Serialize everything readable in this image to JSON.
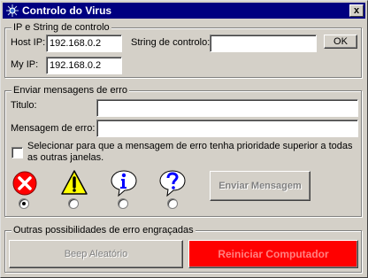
{
  "window": {
    "title": "Controlo do Virus",
    "close_label": "x"
  },
  "ip_group": {
    "legend": "IP e String de controlo",
    "host_ip_label": "Host IP:",
    "host_ip_value": "192.168.0.2",
    "my_ip_label": "My IP:",
    "my_ip_value": "192.168.0.2",
    "control_string_label": "String de controlo:",
    "control_string_value": "",
    "ok_label": "OK"
  },
  "error_group": {
    "legend": "Enviar mensagens de erro",
    "title_label": "Titulo:",
    "title_value": "",
    "message_label": "Mensagem de erro:",
    "message_value": "",
    "priority_checkbox_label": "Selecionar para que a mensagem de erro tenha prioridade superior a todas as outras janelas.",
    "priority_checked": false,
    "icons": [
      "error-icon",
      "warning-icon",
      "information-icon",
      "question-icon"
    ],
    "selected_icon_index": 0,
    "send_label": "Enviar Mensagem"
  },
  "fun_group": {
    "legend": "Outras possibilidades de erro engraçadas",
    "beep_label": "Beep Aleatório",
    "restart_label": "Reiniciar Computador"
  },
  "colors": {
    "titlebar": "#000080",
    "face": "#d4d0c8",
    "restart_button": "#ff0000",
    "restart_text": "#ff8080"
  }
}
